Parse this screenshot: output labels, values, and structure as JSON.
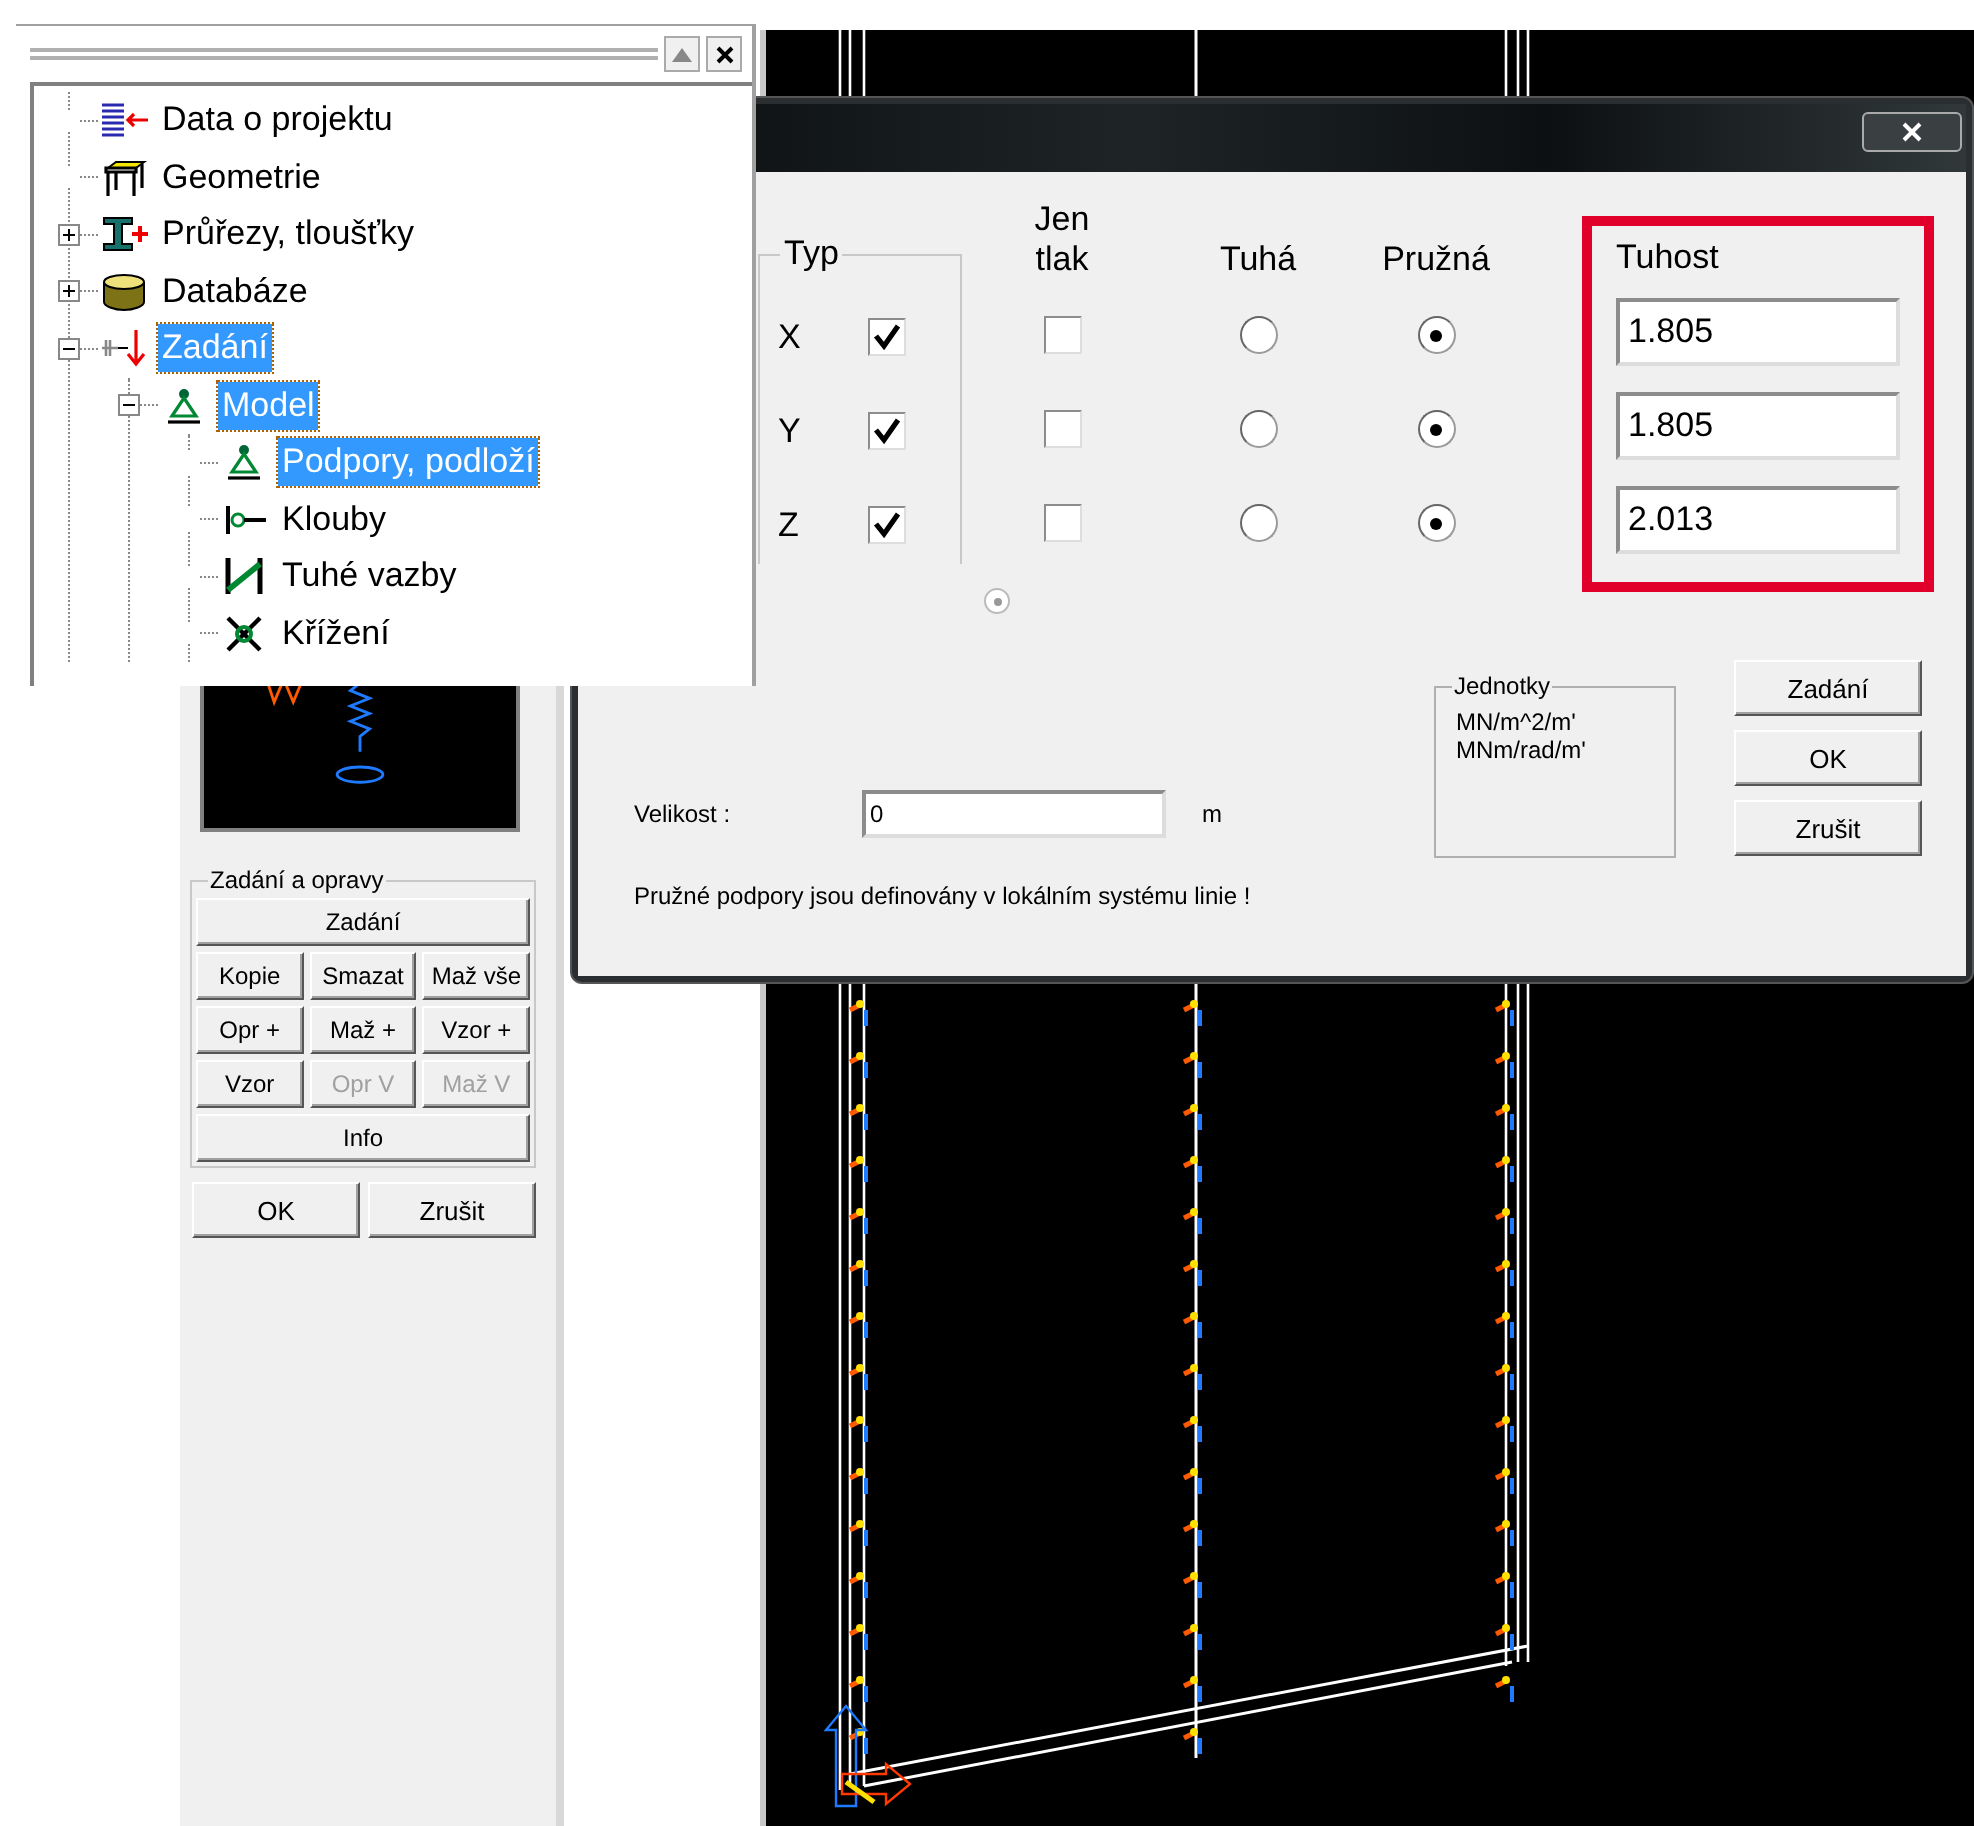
{
  "tree": {
    "items": [
      {
        "label": "Data o projektu",
        "kind": "project",
        "expander": false,
        "selected": false
      },
      {
        "label": "Geometrie",
        "kind": "geometry",
        "expander": false,
        "selected": false
      },
      {
        "label": "Průřezy, tloušťky",
        "kind": "sections",
        "expander": true,
        "expanded": false,
        "selected": false
      },
      {
        "label": "Databáze",
        "kind": "database",
        "expander": true,
        "expanded": false,
        "selected": false
      },
      {
        "label": "Zadání",
        "kind": "input",
        "expander": true,
        "expanded": true,
        "selected": true,
        "children": [
          {
            "label": "Model",
            "kind": "model",
            "expander": true,
            "expanded": true,
            "selected": true,
            "children": [
              {
                "label": "Podpory, podloží",
                "kind": "supports",
                "expander": false,
                "selected": true
              },
              {
                "label": "Klouby",
                "kind": "hinges",
                "expander": false,
                "selected": false
              },
              {
                "label": "Tuhé vazby",
                "kind": "rigid",
                "expander": false,
                "selected": false
              },
              {
                "label": "Křížení",
                "kind": "crossing",
                "expander": false,
                "selected": false
              }
            ]
          }
        ]
      }
    ]
  },
  "left_panel": {
    "group_title": "Zadání a opravy",
    "button_rows": [
      [
        {
          "label": "Zadání",
          "disabled": false
        }
      ],
      [
        {
          "label": "Kopie",
          "disabled": false
        },
        {
          "label": "Smazat",
          "disabled": false
        },
        {
          "label": "Maž vše",
          "disabled": false
        }
      ],
      [
        {
          "label": "Opr +",
          "disabled": false
        },
        {
          "label": "Maž +",
          "disabled": false
        },
        {
          "label": "Vzor +",
          "disabled": false
        }
      ],
      [
        {
          "label": "Vzor",
          "disabled": false
        },
        {
          "label": "Opr V",
          "disabled": true
        },
        {
          "label": "Maž V",
          "disabled": true
        }
      ],
      [
        {
          "label": "Info",
          "disabled": false
        }
      ]
    ],
    "ok": "OK",
    "cancel": "Zrušit"
  },
  "dialog": {
    "headers": {
      "type": "Typ",
      "compression_only": "Jen tlak",
      "rigid": "Tuhá",
      "elastic": "Pružná",
      "stiffness": "Tuhost"
    },
    "rows": [
      {
        "axis": "X",
        "type_checked": true,
        "compression_only": false,
        "rigid_selected": false,
        "elastic_selected": true,
        "stiffness": "1.805"
      },
      {
        "axis": "Y",
        "type_checked": true,
        "compression_only": false,
        "rigid_selected": false,
        "elastic_selected": true,
        "stiffness": "1.805"
      },
      {
        "axis": "Z",
        "type_checked": true,
        "compression_only": false,
        "rigid_selected": false,
        "elastic_selected": true,
        "stiffness": "2.013"
      }
    ],
    "extra_option": {
      "selected": true,
      "disabled": true
    },
    "units": {
      "title": "Jednotky",
      "lines": [
        "MN/m^2/m'",
        "MNm/rad/m'"
      ]
    },
    "size": {
      "label": "Velikost :",
      "value": "0",
      "unit": "m"
    },
    "note": "Pružné podpory jsou definovány v lokálním systému linie !",
    "buttons": [
      "Zadání",
      "OK",
      "Zrušit"
    ]
  }
}
